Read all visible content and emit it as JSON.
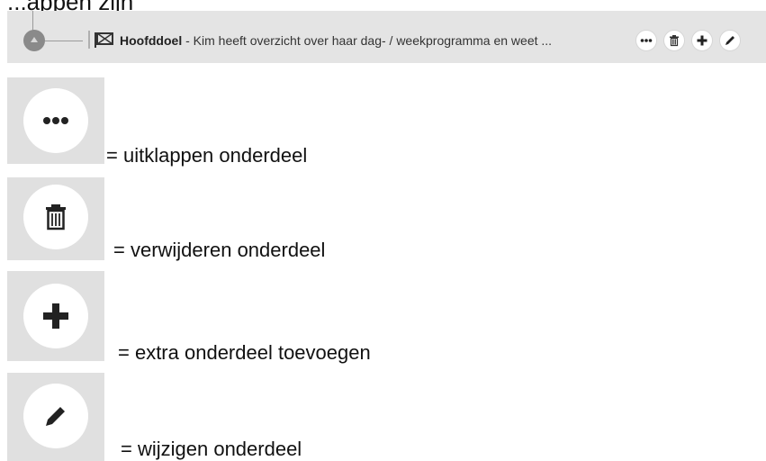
{
  "page": {
    "partial_heading": "...appen zijn"
  },
  "banner": {
    "goal_label": "Hoofddoel",
    "goal_text": " - Kim heeft overzicht over  haar dag- / weekprogramma en weet ...",
    "buttons": [
      "more-icon",
      "trash-icon",
      "plus-icon",
      "pencil-icon"
    ]
  },
  "legend": [
    {
      "icon": "more-icon",
      "text": "= uitklappen onderdeel"
    },
    {
      "icon": "trash-icon",
      "text": "= verwijderen onderdeel"
    },
    {
      "icon": "plus-icon",
      "text": "= extra onderdeel toevoegen"
    },
    {
      "icon": "pencil-icon",
      "text": "= wijzigen onderdeel"
    }
  ],
  "colors": {
    "banner_bg": "#e4e4e4",
    "tile_bg": "#e0e0e0",
    "icon": "#222222"
  }
}
